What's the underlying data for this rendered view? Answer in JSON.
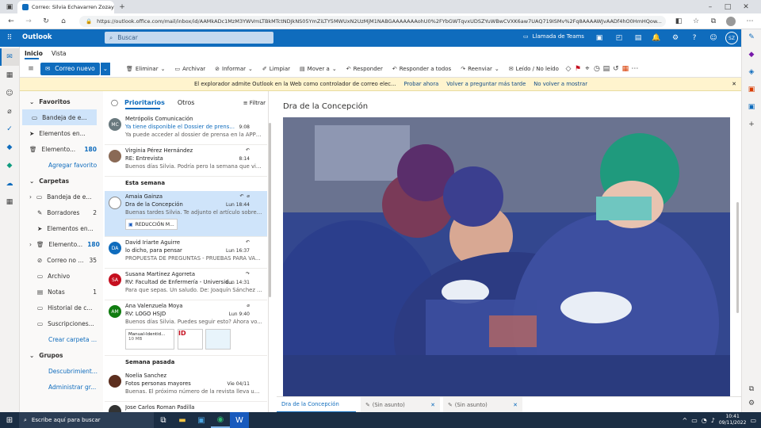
{
  "browser": {
    "tab_title": "Correo: Silvia Echavarren Zozaya",
    "url": "https://outlook.office.com/mail/inbox/id/AAMkADc1MzM3YWVmLTBkMTctNDJkNS05YmZiLTY5MWUxN2UzMjM1NABGAAAAAAAohU0%2FYbGWTqvxUDSZYuWBwCVXK6aw7UAQ719ISMv%2Fq8AAAAWJvAADf4hO0HmHQow..."
  },
  "header": {
    "app_name": "Outlook",
    "search_placeholder": "Buscar",
    "teams_call": "Llamada de Teams",
    "avatar": "SZ"
  },
  "ribbon": {
    "tabs": [
      "Inicio",
      "Vista"
    ],
    "new_mail": "Correo nuevo",
    "actions": [
      "Eliminar",
      "Archivar",
      "Informar",
      "Limpiar",
      "Mover a",
      "Responder",
      "Responder a todos",
      "Reenviar",
      "Leído / No leído"
    ]
  },
  "infobar": {
    "text": "El explorador admite Outlook en la Web como controlador de correo elec...",
    "try_now": "Probar ahora",
    "ask_later": "Volver a preguntar más tarde",
    "dont_show": "No volver a mostrar"
  },
  "folders": {
    "favorites_title": "Favoritos",
    "favorites": [
      {
        "label": "Bandeja de e...",
        "count": ""
      },
      {
        "label": "Elementos en...",
        "count": ""
      },
      {
        "label": "Elemento...",
        "count": "180"
      }
    ],
    "add_favorite": "Agregar favorito",
    "folders_title": "Carpetas",
    "items": [
      {
        "label": "Bandeja de e...",
        "count": ""
      },
      {
        "label": "Borradores",
        "count": "2"
      },
      {
        "label": "Elementos en...",
        "count": ""
      },
      {
        "label": "Elemento...",
        "count": "180"
      },
      {
        "label": "Correo no ...",
        "count": "35"
      },
      {
        "label": "Archivo",
        "count": ""
      },
      {
        "label": "Notas",
        "count": "1"
      },
      {
        "label": "Historial de c...",
        "count": ""
      },
      {
        "label": "Suscripciones...",
        "count": ""
      }
    ],
    "new_folder": "Crear carpeta ...",
    "groups_title": "Grupos",
    "discover": "Descubrimient...",
    "manage": "Administrar gr..."
  },
  "list": {
    "tab_focused": "Prioritarios",
    "tab_other": "Otros",
    "filter": "Filtrar",
    "section_week": "Esta semana",
    "section_last": "Semana pasada",
    "messages": [
      {
        "initials": "MC",
        "color": "#69797e",
        "sender": "Metrópolis Comunicación",
        "subject": "Ya tiene disponible el Dossier de prensa SA...",
        "preview": "Ya puede acceder al dossier de prensa en la APP ...",
        "time": "9:08"
      },
      {
        "initials": "",
        "color": "#8a6a56",
        "sender": "Virginia Pérez Hernández",
        "subject": "RE: Entrevista",
        "preview": "Buenos días Silvia. Podría pero la semana que vie...",
        "time": "8:14"
      },
      {
        "initials": "",
        "color": "#fff",
        "sender": "Amaia Gainza",
        "subject": "Dra de la Concepción",
        "preview": "Buenas tardes Silvia. Te adjunto el artículo sobre ...",
        "time": "Lun 18:44",
        "attachment": "REDUCCIÓN M..."
      },
      {
        "initials": "DA",
        "color": "#0f6cbd",
        "sender": "David Iriarte Aguirre",
        "subject": "lo dicho, para pensar",
        "preview": "PROPUESTA DE PREGUNTAS - PRUEBAS PARA VA...",
        "time": "Lun 16:37"
      },
      {
        "initials": "SA",
        "color": "#c50f1f",
        "sender": "Susana Martinez Agorreta",
        "subject": "RV: Facultad de Enfermería - Universid...",
        "preview": "Para que sepas. Un saludo. De: Joaquín Sánchez ...",
        "time": "Lun 14:31"
      },
      {
        "initials": "AM",
        "color": "#107c10",
        "sender": "Ana Valenzuela Moya",
        "subject": "RV: LOGO HSJD",
        "preview": "Buenos días Silvia. Puedes seguir esto? Ahora vo...",
        "time": "Lun 9:40",
        "attachment": "Manual-Identid...",
        "att_size": "10 MB"
      },
      {
        "initials": "",
        "color": "#5c2e1e",
        "sender": "Noelia Sanchez",
        "subject": "Fotos personas mayores",
        "preview": "Buenas. El próximo número de la revista lleva un ...",
        "time": "Vie 04/11"
      },
      {
        "initials": "",
        "color": "#333",
        "sender": "Jose Carlos Roman Padilla",
        "subject": "",
        "preview": "",
        "time": ""
      }
    ]
  },
  "reading": {
    "subject": "Dra de la Concepción"
  },
  "bottom_tabs": [
    "Dra de la Concepción",
    "(Sin asunto)",
    "(Sin asunto)"
  ],
  "taskbar": {
    "search": "Escribe aquí para buscar",
    "time": "10:41",
    "date": "09/11/2022"
  }
}
